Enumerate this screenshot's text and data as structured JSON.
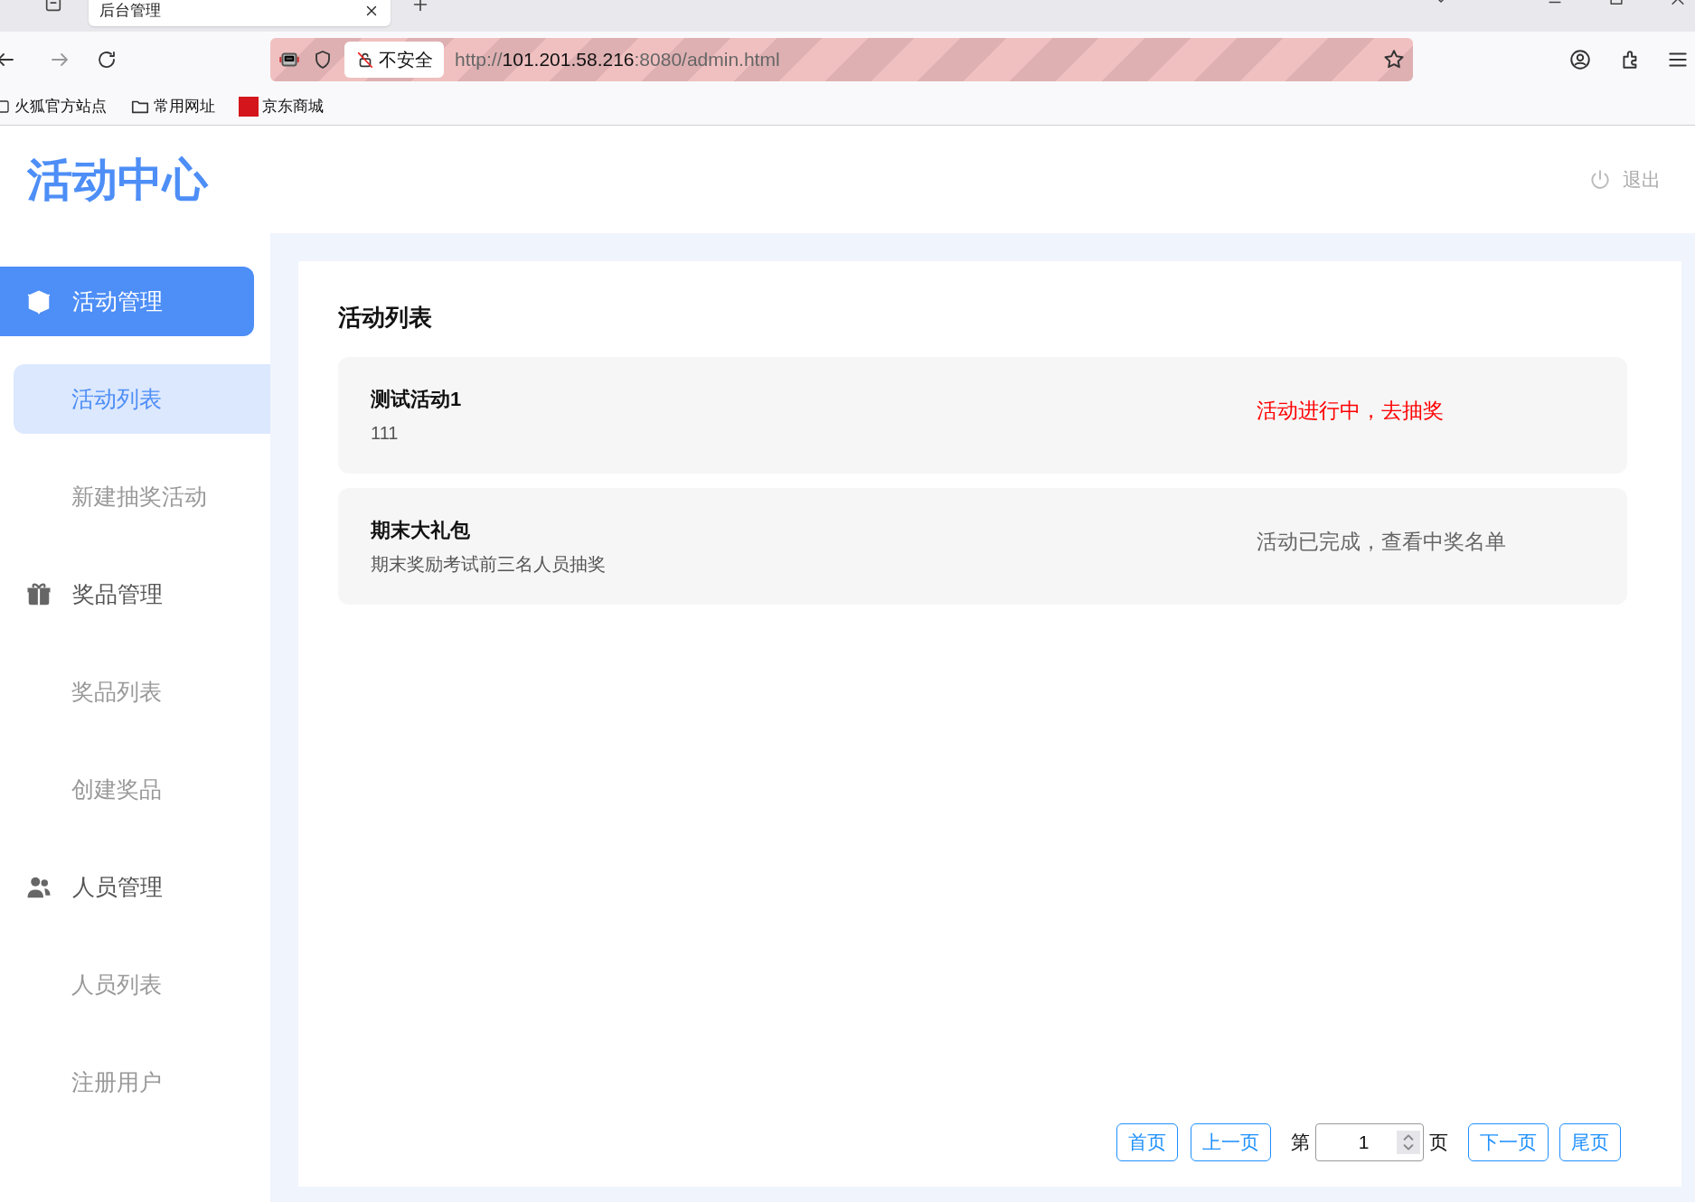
{
  "browser": {
    "tab_title": "后台管理",
    "url_scheme": "http://",
    "url_host": "101.201.58.216",
    "url_rest": ":8080/admin.html",
    "security_label": "不安全",
    "bookmarks": [
      {
        "label": "火狐官方站点"
      },
      {
        "label": "常用网址"
      },
      {
        "label": "京东商城"
      }
    ]
  },
  "header": {
    "logo": "活动中心",
    "logout": "退出"
  },
  "sidebar": {
    "groups": [
      {
        "label": "活动管理",
        "selected": true,
        "children": [
          {
            "label": "活动列表",
            "selected": true
          },
          {
            "label": "新建抽奖活动",
            "selected": false
          }
        ]
      },
      {
        "label": "奖品管理",
        "selected": false,
        "children": [
          {
            "label": "奖品列表",
            "selected": false
          },
          {
            "label": "创建奖品",
            "selected": false
          }
        ]
      },
      {
        "label": "人员管理",
        "selected": false,
        "children": [
          {
            "label": "人员列表",
            "selected": false
          },
          {
            "label": "注册用户",
            "selected": false
          }
        ]
      }
    ]
  },
  "content": {
    "title": "活动列表",
    "activities": [
      {
        "title": "测试活动1",
        "description": "111",
        "status": "活动进行中，去抽奖",
        "kind": "active"
      },
      {
        "title": "期末大礼包",
        "description": "期末奖励考试前三名人员抽奖",
        "status": "活动已完成，查看中奖名单",
        "kind": "done"
      }
    ],
    "pagination": {
      "buttons_before": [
        "首页",
        "上一页"
      ],
      "page_label": "第",
      "page_input": "1",
      "page_unit": "页",
      "buttons_after": [
        "下一页",
        "尾页"
      ]
    }
  }
}
